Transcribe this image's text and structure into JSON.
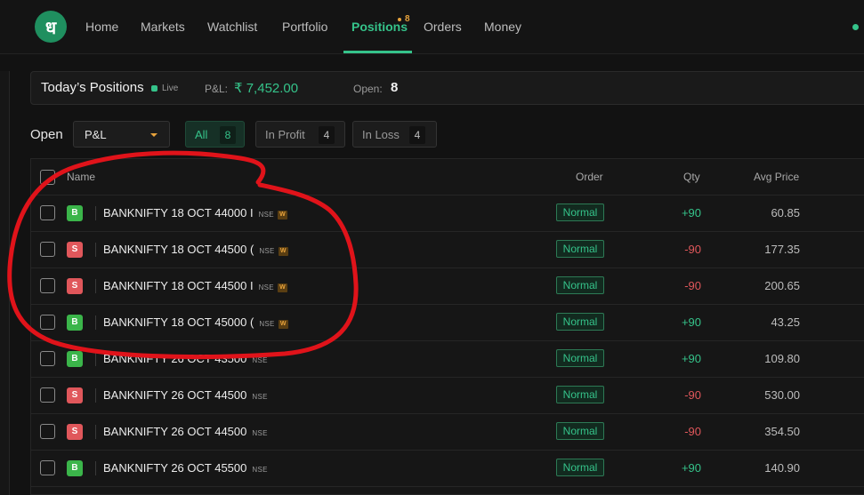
{
  "colors": {
    "accent": "#35c38a",
    "sell": "#e0575b",
    "buy": "#3bb54a",
    "warning": "#e8a33c",
    "annotation": "#e0131a"
  },
  "logo": {
    "glyph": "ध",
    "icon": "dhan-logo"
  },
  "nav": {
    "items": [
      {
        "label": "Home"
      },
      {
        "label": "Markets"
      },
      {
        "label": "Watchlist"
      },
      {
        "label": "Portfolio"
      },
      {
        "label": "Positions",
        "badge": "8",
        "active": true
      },
      {
        "label": "Orders"
      },
      {
        "label": "Money"
      }
    ]
  },
  "summary": {
    "title": "Today’s Positions",
    "live": "Live",
    "pnl_label": "P&L:",
    "pnl_value": "₹ 7,452.00",
    "open_label": "Open:",
    "open_value": "8"
  },
  "filters": {
    "open_label": "Open",
    "sort_select": "P&L",
    "chips": [
      {
        "label": "All",
        "count": "8",
        "active": true
      },
      {
        "label": "In Profit",
        "count": "4"
      },
      {
        "label": "In Loss",
        "count": "4"
      }
    ]
  },
  "table": {
    "columns": {
      "name": "Name",
      "order": "Order",
      "qty": "Qty",
      "avg": "Avg Price"
    },
    "rows": [
      {
        "side": "B",
        "instrument": "BANKNIFTY 18 OCT 44000 I",
        "exchange": "NSE",
        "weekly": "W",
        "order": "Normal",
        "qty": "+90",
        "avg": "60.85"
      },
      {
        "side": "S",
        "instrument": "BANKNIFTY 18 OCT 44500 (",
        "exchange": "NSE",
        "weekly": "W",
        "order": "Normal",
        "qty": "-90",
        "avg": "177.35"
      },
      {
        "side": "S",
        "instrument": "BANKNIFTY 18 OCT 44500 I",
        "exchange": "NSE",
        "weekly": "W",
        "order": "Normal",
        "qty": "-90",
        "avg": "200.65"
      },
      {
        "side": "B",
        "instrument": "BANKNIFTY 18 OCT 45000 (",
        "exchange": "NSE",
        "weekly": "W",
        "order": "Normal",
        "qty": "+90",
        "avg": "43.25"
      },
      {
        "side": "B",
        "instrument": "BANKNIFTY 26 OCT 43500",
        "exchange": "NSE",
        "weekly": "",
        "order": "Normal",
        "qty": "+90",
        "avg": "109.80"
      },
      {
        "side": "S",
        "instrument": "BANKNIFTY 26 OCT 44500",
        "exchange": "NSE",
        "weekly": "",
        "order": "Normal",
        "qty": "-90",
        "avg": "530.00"
      },
      {
        "side": "S",
        "instrument": "BANKNIFTY 26 OCT 44500",
        "exchange": "NSE",
        "weekly": "",
        "order": "Normal",
        "qty": "-90",
        "avg": "354.50"
      },
      {
        "side": "B",
        "instrument": "BANKNIFTY 26 OCT 45500",
        "exchange": "NSE",
        "weekly": "",
        "order": "Normal",
        "qty": "+90",
        "avg": "140.90"
      }
    ]
  }
}
